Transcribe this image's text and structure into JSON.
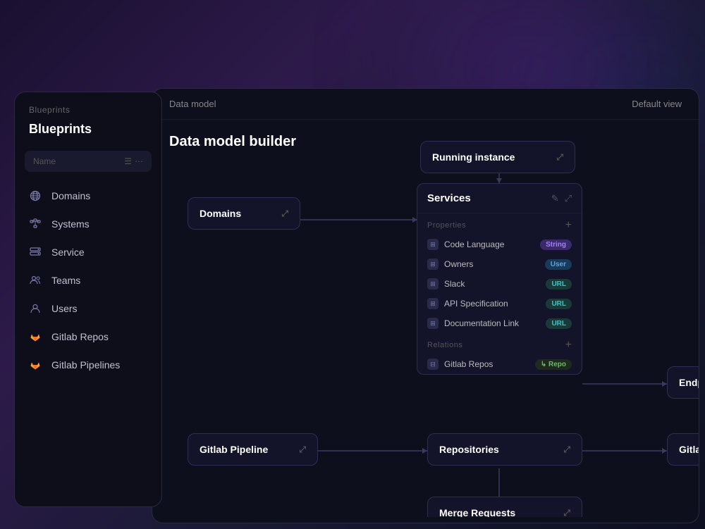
{
  "sidebar": {
    "header": "Blueprints",
    "title": "Blueprints",
    "search": {
      "placeholder": "Name",
      "filter_icon": "☰",
      "more_icon": "⋯"
    },
    "items": [
      {
        "id": "domains",
        "label": "Domains",
        "icon": "globe"
      },
      {
        "id": "systems",
        "label": "Systems",
        "icon": "network"
      },
      {
        "id": "service",
        "label": "Service",
        "icon": "server"
      },
      {
        "id": "teams",
        "label": "Teams",
        "icon": "users"
      },
      {
        "id": "users",
        "label": "Users",
        "icon": "user"
      },
      {
        "id": "gitlab-repos",
        "label": "Gitlab Repos",
        "icon": "gitlab"
      },
      {
        "id": "gitlab-pipelines",
        "label": "Gitlab Pipelines",
        "icon": "gitlab"
      }
    ]
  },
  "main": {
    "header_title": "Data model",
    "header_view": "Default view",
    "canvas_title": "Data model builder",
    "nodes": {
      "running_instance": "Running instance",
      "domains": "Domains",
      "services": "Services",
      "endpoint": "Endpoint",
      "gitlab_pipeline": "Gitlab Pipeline",
      "repositories": "Repositories",
      "gitlab_issues": "Gitlab Issues",
      "merge_requests": "Merge Requests"
    },
    "services_card": {
      "title": "Services",
      "sections": {
        "properties": {
          "label": "Properties",
          "items": [
            {
              "name": "Code Language",
              "badge": "String",
              "badge_class": "badge-string"
            },
            {
              "name": "Owners",
              "badge": "User",
              "badge_class": "badge-user"
            },
            {
              "name": "Slack",
              "badge": "URL",
              "badge_class": "badge-url"
            },
            {
              "name": "API Specification",
              "badge": "URL",
              "badge_class": "badge-url"
            },
            {
              "name": "Documentation Link",
              "badge": "URL",
              "badge_class": "badge-url"
            }
          ]
        },
        "relations": {
          "label": "Relations",
          "items": [
            {
              "name": "Gitlab Repos",
              "badge": "↳ Repo",
              "badge_class": "badge-repo"
            }
          ]
        }
      }
    }
  },
  "colors": {
    "accent_purple": "#7a40ff",
    "node_bg": "#13142a",
    "node_border": "#2e2e50",
    "canvas_bg": "#0e0f1c",
    "sidebar_bg": "#0e0e1a"
  }
}
